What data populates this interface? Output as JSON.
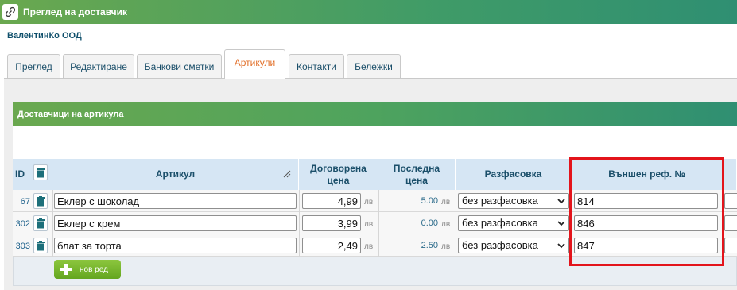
{
  "window": {
    "title": "Преглед на доставчик",
    "icon": "link-icon"
  },
  "company_name": "ВалентинКо ООД",
  "tabs": [
    {
      "label": "Преглед"
    },
    {
      "label": "Редактиране"
    },
    {
      "label": "Банкови сметки"
    },
    {
      "label": "Артикули"
    },
    {
      "label": "Контакти"
    },
    {
      "label": "Бележки"
    }
  ],
  "active_tab": "Артикули",
  "section": {
    "title": "Доставчици на артикула"
  },
  "table": {
    "headers": {
      "id": "ID",
      "article": "Артикул",
      "agreed_price": "Договорена цена",
      "last_price": "Последна цена",
      "packaging": "Разфасовка",
      "external_ref": "Външен реф. №"
    },
    "rows": [
      {
        "id": "67",
        "article": "Еклер с шоколад",
        "agreed_price": "4,99",
        "unit": "лв",
        "last_price": "5.00",
        "last_unit": "лв",
        "packaging": "без разфасовка",
        "external_ref": "814"
      },
      {
        "id": "302",
        "article": "Еклер с крем",
        "agreed_price": "3,99",
        "unit": "лв",
        "last_price": "0.00",
        "last_unit": "лв",
        "packaging": "без разфасовка",
        "external_ref": "846"
      },
      {
        "id": "303",
        "article": "блат за торта",
        "agreed_price": "2,49",
        "unit": "лв",
        "last_price": "2.50",
        "last_unit": "лв",
        "packaging": "без разфасовка",
        "external_ref": "847"
      }
    ]
  },
  "new_row_button": {
    "label": "нов ред",
    "icon": "plus-icon"
  },
  "colors": {
    "header_green": "#6aa84f",
    "header_teal": "#2f8f72",
    "active_tab_text": "#e2702a",
    "highlight_red": "#e3141b"
  }
}
